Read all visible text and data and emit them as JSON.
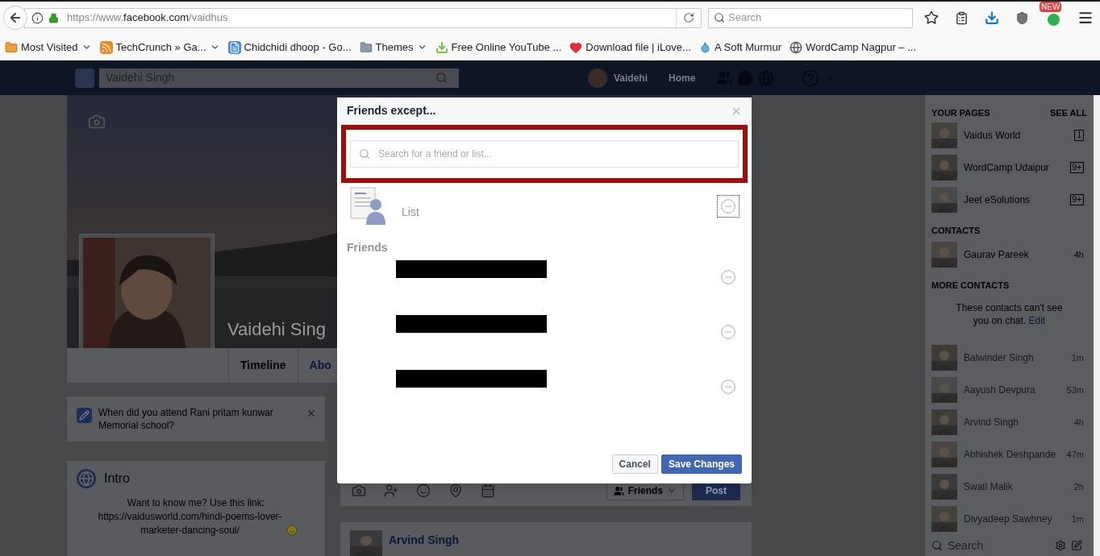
{
  "browser": {
    "url_prefix": "https://www.",
    "url_domain": "facebook.com",
    "url_path": "/vaidhus",
    "search_placeholder": "Search",
    "badge": "NEW"
  },
  "bookmarks": [
    {
      "label": "Most Visited",
      "kind": "folder-star",
      "menu": true
    },
    {
      "label": "TechCrunch » Ga...",
      "kind": "feed",
      "menu": true
    },
    {
      "label": "Chidchidi dhoop - Go...",
      "kind": "doc",
      "menu": false
    },
    {
      "label": "Themes",
      "kind": "folder",
      "menu": true
    },
    {
      "label": "Free Online YouTube ...",
      "kind": "download",
      "menu": false
    },
    {
      "label": "Download file | iLove...",
      "kind": "heart",
      "menu": false
    },
    {
      "label": "A Soft Murmur",
      "kind": "drop",
      "menu": false
    },
    {
      "label": "WordCamp Nagpur – ...",
      "kind": "wp",
      "menu": false
    }
  ],
  "fb_header": {
    "search_value": "Vaidehi Singh",
    "user": "Vaidehi",
    "home": "Home"
  },
  "profile": {
    "name": "Vaidehi Sing",
    "tabs": [
      {
        "label": "Timeline",
        "selected": true
      },
      {
        "label": "Abo",
        "selected": false
      }
    ]
  },
  "question": "When did you attend Rani pritam kunwar Memorial school?",
  "intro": {
    "title": "Intro",
    "text": "Want to know me? Use this link:",
    "link": "https://vaidusworld.com/hindi-poems-lover-marketer-dancing-soul/"
  },
  "composer": {
    "audience": "Friends",
    "post": "Post"
  },
  "post": {
    "author": "Arvind Singh"
  },
  "sidebar": {
    "pages_heading": "YOUR PAGES",
    "see_all": "SEE ALL",
    "pages": [
      {
        "name": "Vaidus World",
        "badge": "1"
      },
      {
        "name": "WordCamp Udaipur",
        "badge": "9+"
      },
      {
        "name": "Jeet eSolutions",
        "badge": "9+"
      }
    ],
    "contacts_heading": "CONTACTS",
    "contacts": [
      {
        "name": "Gaurav Pareek",
        "time": "4h"
      }
    ],
    "more_heading": "MORE CONTACTS",
    "notice": "These contacts can't see you on chat.",
    "notice_link": "Edit",
    "more_contacts": [
      {
        "name": "Balwinder Singh",
        "time": "1m",
        "offline": true
      },
      {
        "name": "Aayush Devpura",
        "time": "53m",
        "offline": true
      },
      {
        "name": "Arvind Singh",
        "time": "4h",
        "offline": true
      },
      {
        "name": "Abhishek Deshpande",
        "time": "47m",
        "offline": true
      },
      {
        "name": "Swati Malik",
        "time": "2h",
        "offline": true
      },
      {
        "name": "Divyadeep Sawhney",
        "time": "1m",
        "offline": true
      }
    ],
    "search_placeholder": "Search"
  },
  "dialog": {
    "title": "Friends except...",
    "search_placeholder": "Search for a friend or list...",
    "lists": [
      {
        "label": "List",
        "focused": true
      }
    ],
    "friends_heading": "Friends",
    "friends": [
      {
        "kind": "redacted",
        "focused": false
      },
      {
        "kind": "redacted",
        "focused": false
      },
      {
        "kind": "redacted",
        "focused": false
      }
    ],
    "cancel": "Cancel",
    "save": "Save Changes"
  }
}
